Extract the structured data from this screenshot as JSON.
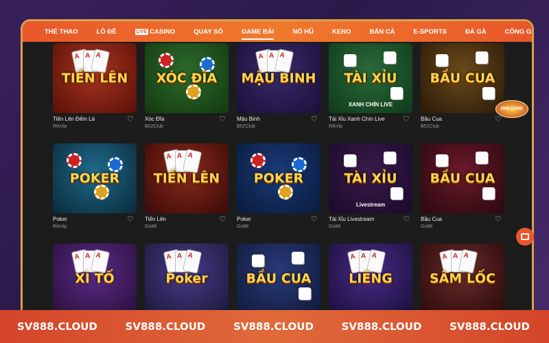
{
  "nav": {
    "items": [
      {
        "label": "THỂ THAO"
      },
      {
        "label": "LÔ ĐỀ"
      },
      {
        "label": "CASINO",
        "tag": "LIVE"
      },
      {
        "label": "QUAY SỐ"
      },
      {
        "label": "GAME BÀI",
        "active": true
      },
      {
        "label": "NỔ HŨ"
      },
      {
        "label": "KENO"
      },
      {
        "label": "BẮN CÁ"
      },
      {
        "label": "E-SPORTS"
      },
      {
        "label": "ĐÁ GÀ"
      },
      {
        "label": "CỔNG GAMES"
      }
    ]
  },
  "games": [
    {
      "thumb_title": "TIẾN LÊN",
      "name": "Tiến Lên Đếm Lá",
      "provider": "RikVip",
      "bg": "#a8351f",
      "bg2": "#5a1008",
      "deco": "cards"
    },
    {
      "thumb_title": "XÓC ĐĨA",
      "name": "Xóc Đĩa",
      "provider": "B52Club",
      "bg": "#2d6a2a",
      "bg2": "#123a10",
      "deco": "chips"
    },
    {
      "thumb_title": "MẬU BINH",
      "name": "Mậu Binh",
      "provider": "B52Club",
      "bg": "#3a2a6a",
      "bg2": "#1a103a",
      "deco": "cards"
    },
    {
      "thumb_title": "TÀI   XỈU",
      "name": "Tài Xỉu Xanh Chín Live",
      "provider": "RikVip",
      "bg": "#2a6a3a",
      "bg2": "#0f3a1a",
      "deco": "dice",
      "sub_badge": "XANH CHÍN LIVE"
    },
    {
      "thumb_title": "BẦU CUA",
      "name": "Bầu Cua",
      "provider": "B52Club",
      "bg": "#6a4a1a",
      "bg2": "#2a1a08",
      "deco": "dice"
    },
    {
      "thumb_title": "POKER",
      "name": "Poker",
      "provider": "RikVip",
      "bg": "#1f6a8a",
      "bg2": "#0a2a3a",
      "deco": "chips"
    },
    {
      "thumb_title": "TIẾN LÊN",
      "name": "Tiến Lên",
      "provider": "Go88",
      "bg": "#8a2a1a",
      "bg2": "#3a0a08",
      "deco": "cards"
    },
    {
      "thumb_title": "POKER",
      "name": "Poker",
      "provider": "Go88",
      "bg": "#1a3a7a",
      "bg2": "#0a1a3a",
      "deco": "chips"
    },
    {
      "thumb_title": "TÀI XỈU",
      "name": "Tài Xỉu Livestream",
      "provider": "Go88",
      "bg": "#3a1a4a",
      "bg2": "#1a0a2a",
      "deco": "dice",
      "sub_badge": "Livestream"
    },
    {
      "thumb_title": "BẦU CUA",
      "name": "Bầu Cua",
      "provider": "Go88",
      "bg": "#6a1a2a",
      "bg2": "#2a0810",
      "deco": "dice"
    },
    {
      "thumb_title": "XÌ TỐ",
      "name": "",
      "provider": "",
      "bg": "#5a2a8a",
      "bg2": "#2a103a",
      "deco": "cards"
    },
    {
      "thumb_title": "Poker",
      "name": "",
      "provider": "",
      "bg": "#4a3a8a",
      "bg2": "#1a1a3a",
      "deco": "cards"
    },
    {
      "thumb_title": "BẦU CUA",
      "name": "",
      "provider": "",
      "bg": "#2a3a7a",
      "bg2": "#101a3a",
      "deco": "dice"
    },
    {
      "thumb_title": "LIÊNG",
      "name": "",
      "provider": "",
      "bg": "#4a2a8a",
      "bg2": "#1a103a",
      "deco": "cards"
    },
    {
      "thumb_title": "SÂM LỐC",
      "name": "",
      "provider": "",
      "bg": "#6a2a2a",
      "bg2": "#2a0a0a",
      "deco": "cards"
    }
  ],
  "minigame_badge": "MINI GAME",
  "footer": {
    "domains": [
      "SV888.CLOUD",
      "SV888.CLOUD",
      "SV888.CLOUD",
      "SV888.CLOUD",
      "SV888.CLOUD"
    ]
  },
  "colors": {
    "accent": "#e8572a",
    "frame": "#d9a24a",
    "title_gold": "#ffd54a"
  }
}
